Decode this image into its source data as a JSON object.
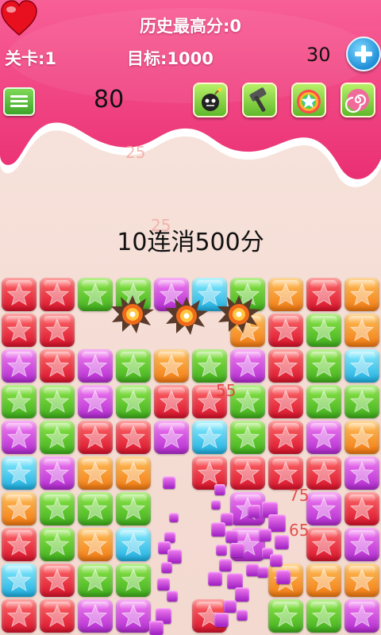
{
  "header": {
    "best_score": "历史最高分:0",
    "level": "关卡:1",
    "target": "目标:1000",
    "lives": "30",
    "score": "80"
  },
  "toolbar": {
    "menu_icon": "list-icon",
    "tools": [
      {
        "name": "bomb-tool-button",
        "icon": "bomb-icon"
      },
      {
        "name": "hammer-tool-button",
        "icon": "hammer-icon"
      },
      {
        "name": "rainbow-tool-button",
        "icon": "rainbow-star-icon"
      },
      {
        "name": "swirl-tool-button",
        "icon": "swirl-icon"
      }
    ]
  },
  "combo_message": "10连消500分",
  "floating_points": [
    "25",
    "25",
    "55",
    "75",
    "65"
  ],
  "colors": {
    "R": "#e8203a",
    "G": "#4fc02a",
    "P": "#d050e6",
    "O": "#f79a2a",
    "C": "#3cc8f0",
    "syrup": "#f0437f",
    "accent": "#1e8ed6"
  },
  "board": {
    "columns": 10,
    "rows": 10,
    "grid": [
      "RRGGPCGORO",
      "RR....ORGO",
      "PRPGOGPRGC",
      "GGPGRRGRGG",
      "PGRRPCGRPO",
      "CPOO.RRRRP",
      "OGGG..P.PR",
      "RGOC..P.RP",
      "CRGG...OOO",
      "RRPP.R.GGP"
    ]
  }
}
